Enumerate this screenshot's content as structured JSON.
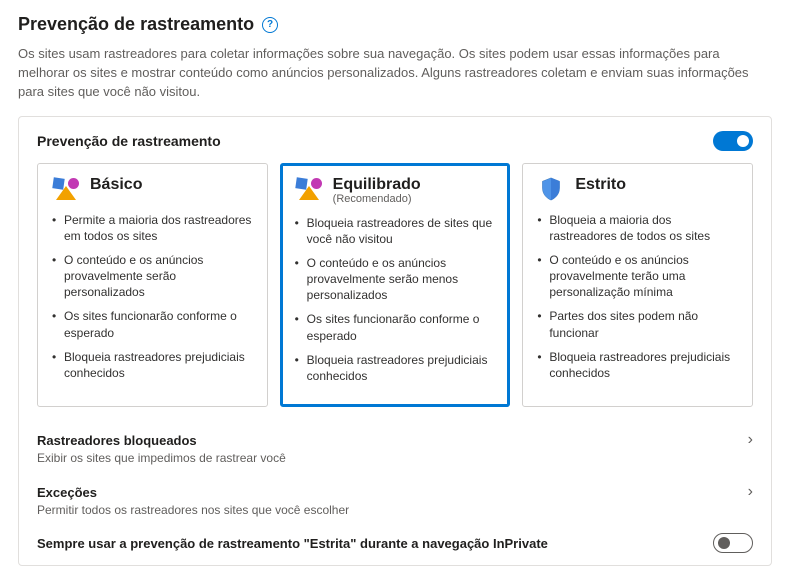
{
  "page": {
    "title": "Prevenção de rastreamento",
    "description": "Os sites usam rastreadores para coletar informações sobre sua navegação. Os sites podem usar essas informações para melhorar os sites e mostrar conteúdo como anúncios personalizados. Alguns rastreadores coletam e enviam suas informações para sites que você não visitou."
  },
  "section": {
    "header": "Prevenção de rastreamento",
    "toggle_on": true
  },
  "cards": {
    "basic": {
      "title": "Básico",
      "bullets": [
        "Permite a maioria dos rastreadores em todos os sites",
        "O conteúdo e os anúncios provavelmente serão personalizados",
        "Os sites funcionarão conforme o esperado",
        "Bloqueia rastreadores prejudiciais conhecidos"
      ]
    },
    "balanced": {
      "title": "Equilibrado",
      "subtitle": "(Recomendado)",
      "bullets": [
        "Bloqueia rastreadores de sites que você não visitou",
        "O conteúdo e os anúncios provavelmente serão menos personalizados",
        "Os sites funcionarão conforme o esperado",
        "Bloqueia rastreadores prejudiciais conhecidos"
      ]
    },
    "strict": {
      "title": "Estrito",
      "bullets": [
        "Bloqueia a maioria dos rastreadores de todos os sites",
        "O conteúdo e os anúncios provavelmente terão uma personalização mínima",
        "Partes dos sites podem não funcionar",
        "Bloqueia rastreadores prejudiciais conhecidos"
      ]
    }
  },
  "links": {
    "blocked": {
      "title": "Rastreadores bloqueados",
      "desc": "Exibir os sites que impedimos de rastrear você"
    },
    "exceptions": {
      "title": "Exceções",
      "desc": "Permitir todos os rastreadores nos sites que você escolher"
    }
  },
  "inprivate": {
    "label": "Sempre usar a prevenção de rastreamento \"Estrita\" durante a navegação InPrivate",
    "toggle_on": false
  }
}
